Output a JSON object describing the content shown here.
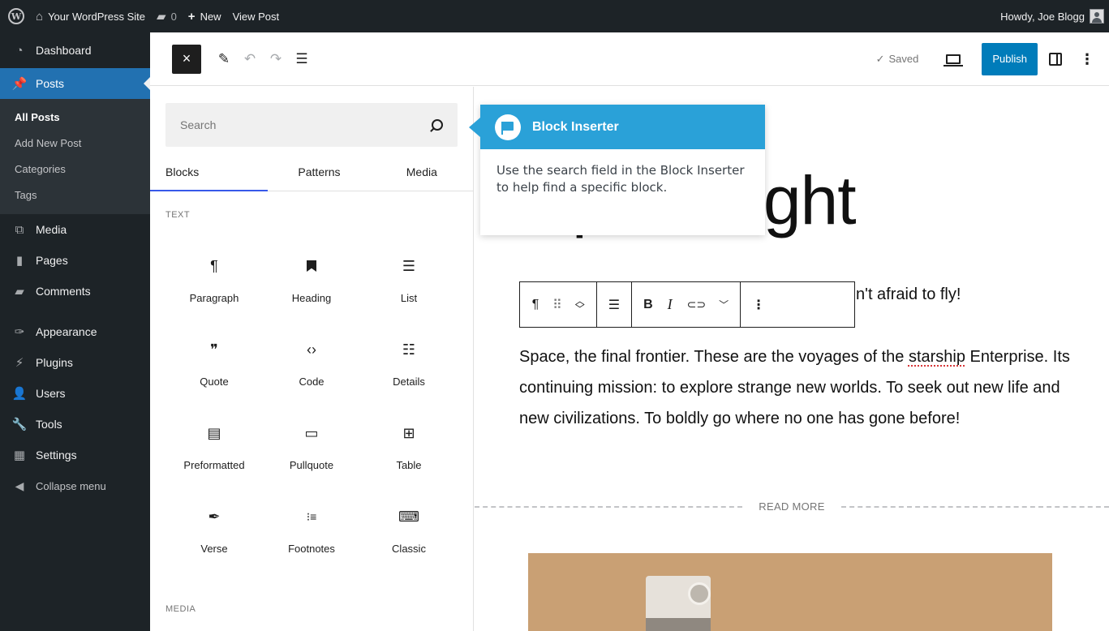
{
  "adminbar": {
    "site_name": "Your WordPress Site",
    "comments_count": "0",
    "new_label": "New",
    "view_post": "View Post",
    "howdy": "Howdy, Joe Blogg"
  },
  "sidebar": {
    "dashboard": "Dashboard",
    "posts": "Posts",
    "submenu": [
      "All Posts",
      "Add New Post",
      "Categories",
      "Tags"
    ],
    "media": "Media",
    "pages": "Pages",
    "comments": "Comments",
    "appearance": "Appearance",
    "plugins": "Plugins",
    "users": "Users",
    "tools": "Tools",
    "settings": "Settings",
    "collapse": "Collapse menu"
  },
  "header": {
    "close": "×",
    "saved": "Saved",
    "publish": "Publish"
  },
  "inserter": {
    "search_placeholder": "Search",
    "tabs": [
      "Blocks",
      "Patterns",
      "Media"
    ],
    "text_category": "TEXT",
    "media_category": "MEDIA",
    "blocks": [
      {
        "label": "Paragraph",
        "icon": "¶"
      },
      {
        "label": "Heading",
        "icon": "🔖"
      },
      {
        "label": "List",
        "icon": "☰"
      },
      {
        "label": "Quote",
        "icon": "❞"
      },
      {
        "label": "Code",
        "icon": "‹›"
      },
      {
        "label": "Details",
        "icon": "☷"
      },
      {
        "label": "Preformatted",
        "icon": "▤"
      },
      {
        "label": "Pullquote",
        "icon": "▭"
      },
      {
        "label": "Table",
        "icon": "⊞"
      },
      {
        "label": "Verse",
        "icon": "✒"
      },
      {
        "label": "Footnotes",
        "icon": "⁝≡"
      },
      {
        "label": "Classic",
        "icon": "⌨"
      }
    ]
  },
  "tooltip": {
    "title": "Block Inserter",
    "body": "Use the search field in the Block Inserter to help find a specific block."
  },
  "content": {
    "title": "Spaceflight",
    "subline": "n't afraid to fly!",
    "paragraph_before": "Space, the final frontier. These are the voyages of the ",
    "starship": "starship",
    "paragraph_after": " Enterprise. Its continuing mission: to explore strange new worlds. To seek out new life and new civilizations. To boldly go where no one has gone before!",
    "read_more": "READ MORE"
  },
  "colors": {
    "admin_dark": "#1d2327",
    "accent_blue": "#2271b1",
    "publish_blue": "#007cba",
    "tooltip_blue": "#2aa1d8"
  }
}
